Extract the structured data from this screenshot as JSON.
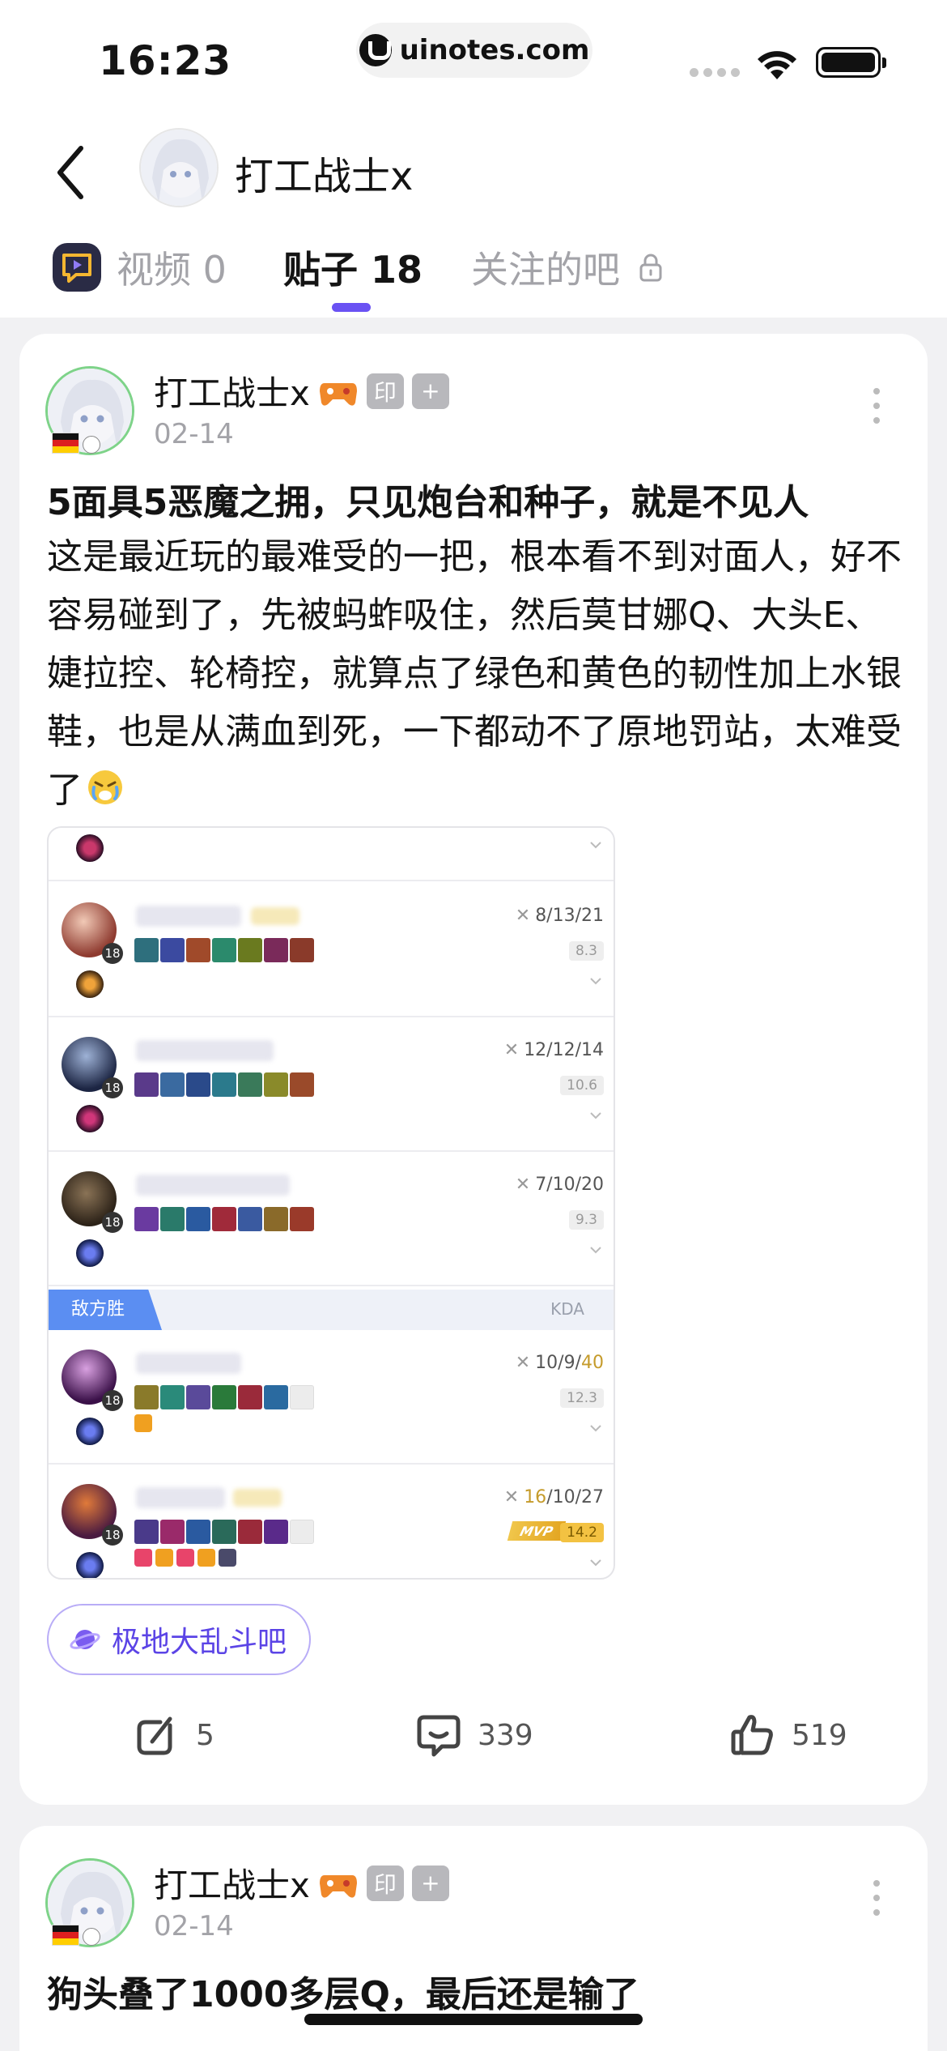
{
  "status_bar": {
    "time": "16:23",
    "url": "uinotes.com"
  },
  "header": {
    "username": "打工战士x"
  },
  "tabs": [
    {
      "label": "视频 0",
      "active": false,
      "icon": "video-icon"
    },
    {
      "label": "贴子 18",
      "active": true
    },
    {
      "label": "关注的吧",
      "active": false,
      "icon": "lock-icon"
    }
  ],
  "colors": {
    "accent": "#6a52f3",
    "link": "#5b44e6",
    "win_tag": "#5b8ef2"
  },
  "posts": [
    {
      "author": "打工战士x",
      "badge_1": "印",
      "badge_2": "+",
      "date": "02-14",
      "title": "5面具5恶魔之拥，只见炮台和种子，就是不见人",
      "body": "这是最近玩的最难受的一把，根本看不到对面人，好不容易碰到了，先被蚂蚱吸住，然后莫甘娜Q、大头E、婕拉控、轮椅控，就算点了绿色和黄色的韧性加上水银鞋，也是从满血到死，一下都动不了原地罚站，太难受了",
      "match": {
        "players": [
          {
            "level": "18",
            "kda": "8/13/21",
            "score": "8.3"
          },
          {
            "level": "18",
            "kda": "12/12/14",
            "score": "10.6"
          },
          {
            "level": "18",
            "kda": "7/10/20",
            "score": "9.3"
          }
        ],
        "team_label": "敌方胜",
        "team_kda_label": "KDA",
        "enemy_players": [
          {
            "level": "18",
            "kda_a": "10/9/",
            "kda_b": "40",
            "score": "12.3"
          },
          {
            "level": "18",
            "kda_a": "16",
            "kda_b": "/10/27",
            "score": "14.2",
            "mvp": "MVP"
          }
        ]
      },
      "forum": "极地大乱斗吧",
      "shares": "5",
      "comments": "339",
      "likes": "519"
    },
    {
      "author": "打工战士x",
      "badge_1": "印",
      "badge_2": "+",
      "date": "02-14",
      "title": "狗头叠了1000多层Q，最后还是输了"
    }
  ]
}
